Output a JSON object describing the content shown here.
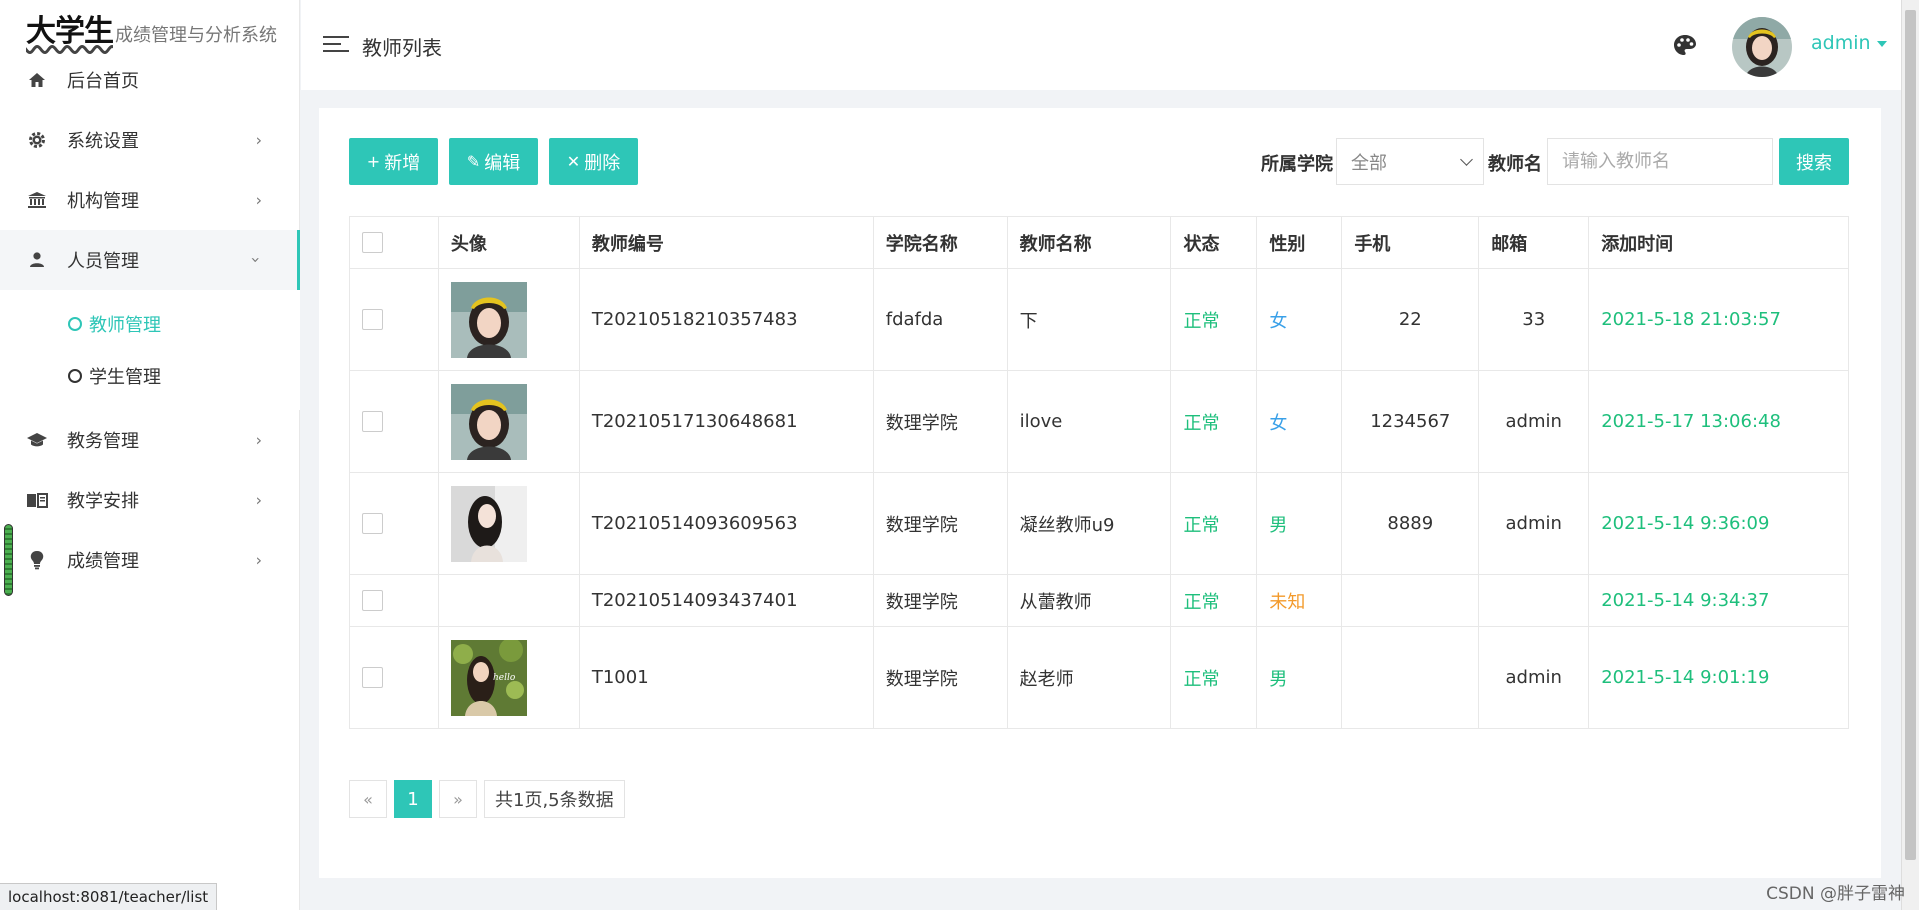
{
  "brand": {
    "big": "大学生",
    "sub": "成绩管理与分析系统"
  },
  "sidebar": {
    "items": [
      {
        "label": "后台首页",
        "icon": "home-icon"
      },
      {
        "label": "系统设置",
        "icon": "gear-icon"
      },
      {
        "label": "机构管理",
        "icon": "bank-icon"
      },
      {
        "label": "人员管理",
        "icon": "user-icon"
      }
    ],
    "sub_items": [
      {
        "label": "教师管理",
        "active": true
      },
      {
        "label": "学生管理",
        "active": false
      }
    ],
    "items_after": [
      {
        "label": "教务管理",
        "icon": "graduation-cap-icon"
      },
      {
        "label": "教学安排",
        "icon": "book-icon"
      },
      {
        "label": "成绩管理",
        "icon": "lightbulb-icon"
      }
    ]
  },
  "header": {
    "title": "教师列表",
    "user": "admin"
  },
  "toolbar": {
    "add": "新增",
    "edit": "编辑",
    "delete": "删除",
    "college_label": "所属学院",
    "college_value": "全部",
    "name_label": "教师名",
    "name_placeholder": "请输入教师名",
    "search": "搜索"
  },
  "table": {
    "headers": [
      "头像",
      "教师编号",
      "学院名称",
      "教师名称",
      "状态",
      "性别",
      "手机",
      "邮箱",
      "添加时间"
    ],
    "rows": [
      {
        "id": "T20210518210357483",
        "college": "fdafda",
        "name": "下",
        "status": "正常",
        "gender": "女",
        "phone": "22",
        "email": "33",
        "time": "2021-5-18 21:03:57",
        "avatar": "girl-yellow-hat",
        "tall": true
      },
      {
        "id": "T20210517130648681",
        "college": "数理学院",
        "name": "ilove",
        "status": "正常",
        "gender": "女",
        "phone": "1234567",
        "email": "admin",
        "time": "2021-5-17 13:06:48",
        "avatar": "girl-yellow-hat",
        "tall": true
      },
      {
        "id": "T20210514093609563",
        "college": "数理学院",
        "name": "凝丝教师u9",
        "status": "正常",
        "gender": "男",
        "phone": "8889",
        "email": "admin",
        "time": "2021-5-14 9:36:09",
        "avatar": "girl-gray",
        "tall": true
      },
      {
        "id": "T20210514093437401",
        "college": "数理学院",
        "name": "从蕾教师",
        "status": "正常",
        "gender": "未知",
        "phone": "",
        "email": "",
        "time": "2021-5-14 9:34:37",
        "avatar": "",
        "tall": false
      },
      {
        "id": "T1001",
        "college": "数理学院",
        "name": "赵老师",
        "status": "正常",
        "gender": "男",
        "phone": "",
        "email": "admin",
        "time": "2021-5-14 9:01:19",
        "avatar": "girl-green",
        "tall": true
      }
    ]
  },
  "pagination": {
    "prev": "«",
    "current": "1",
    "next": "»",
    "info": "共1页,5条数据"
  },
  "status_url": "localhost:8081/teacher/list",
  "watermark": "CSDN @胖子雷神",
  "colors": {
    "accent": "#2ec6b7",
    "green": "#1ebf7c",
    "blue": "#39a0e8",
    "orange": "#f39a2b"
  }
}
